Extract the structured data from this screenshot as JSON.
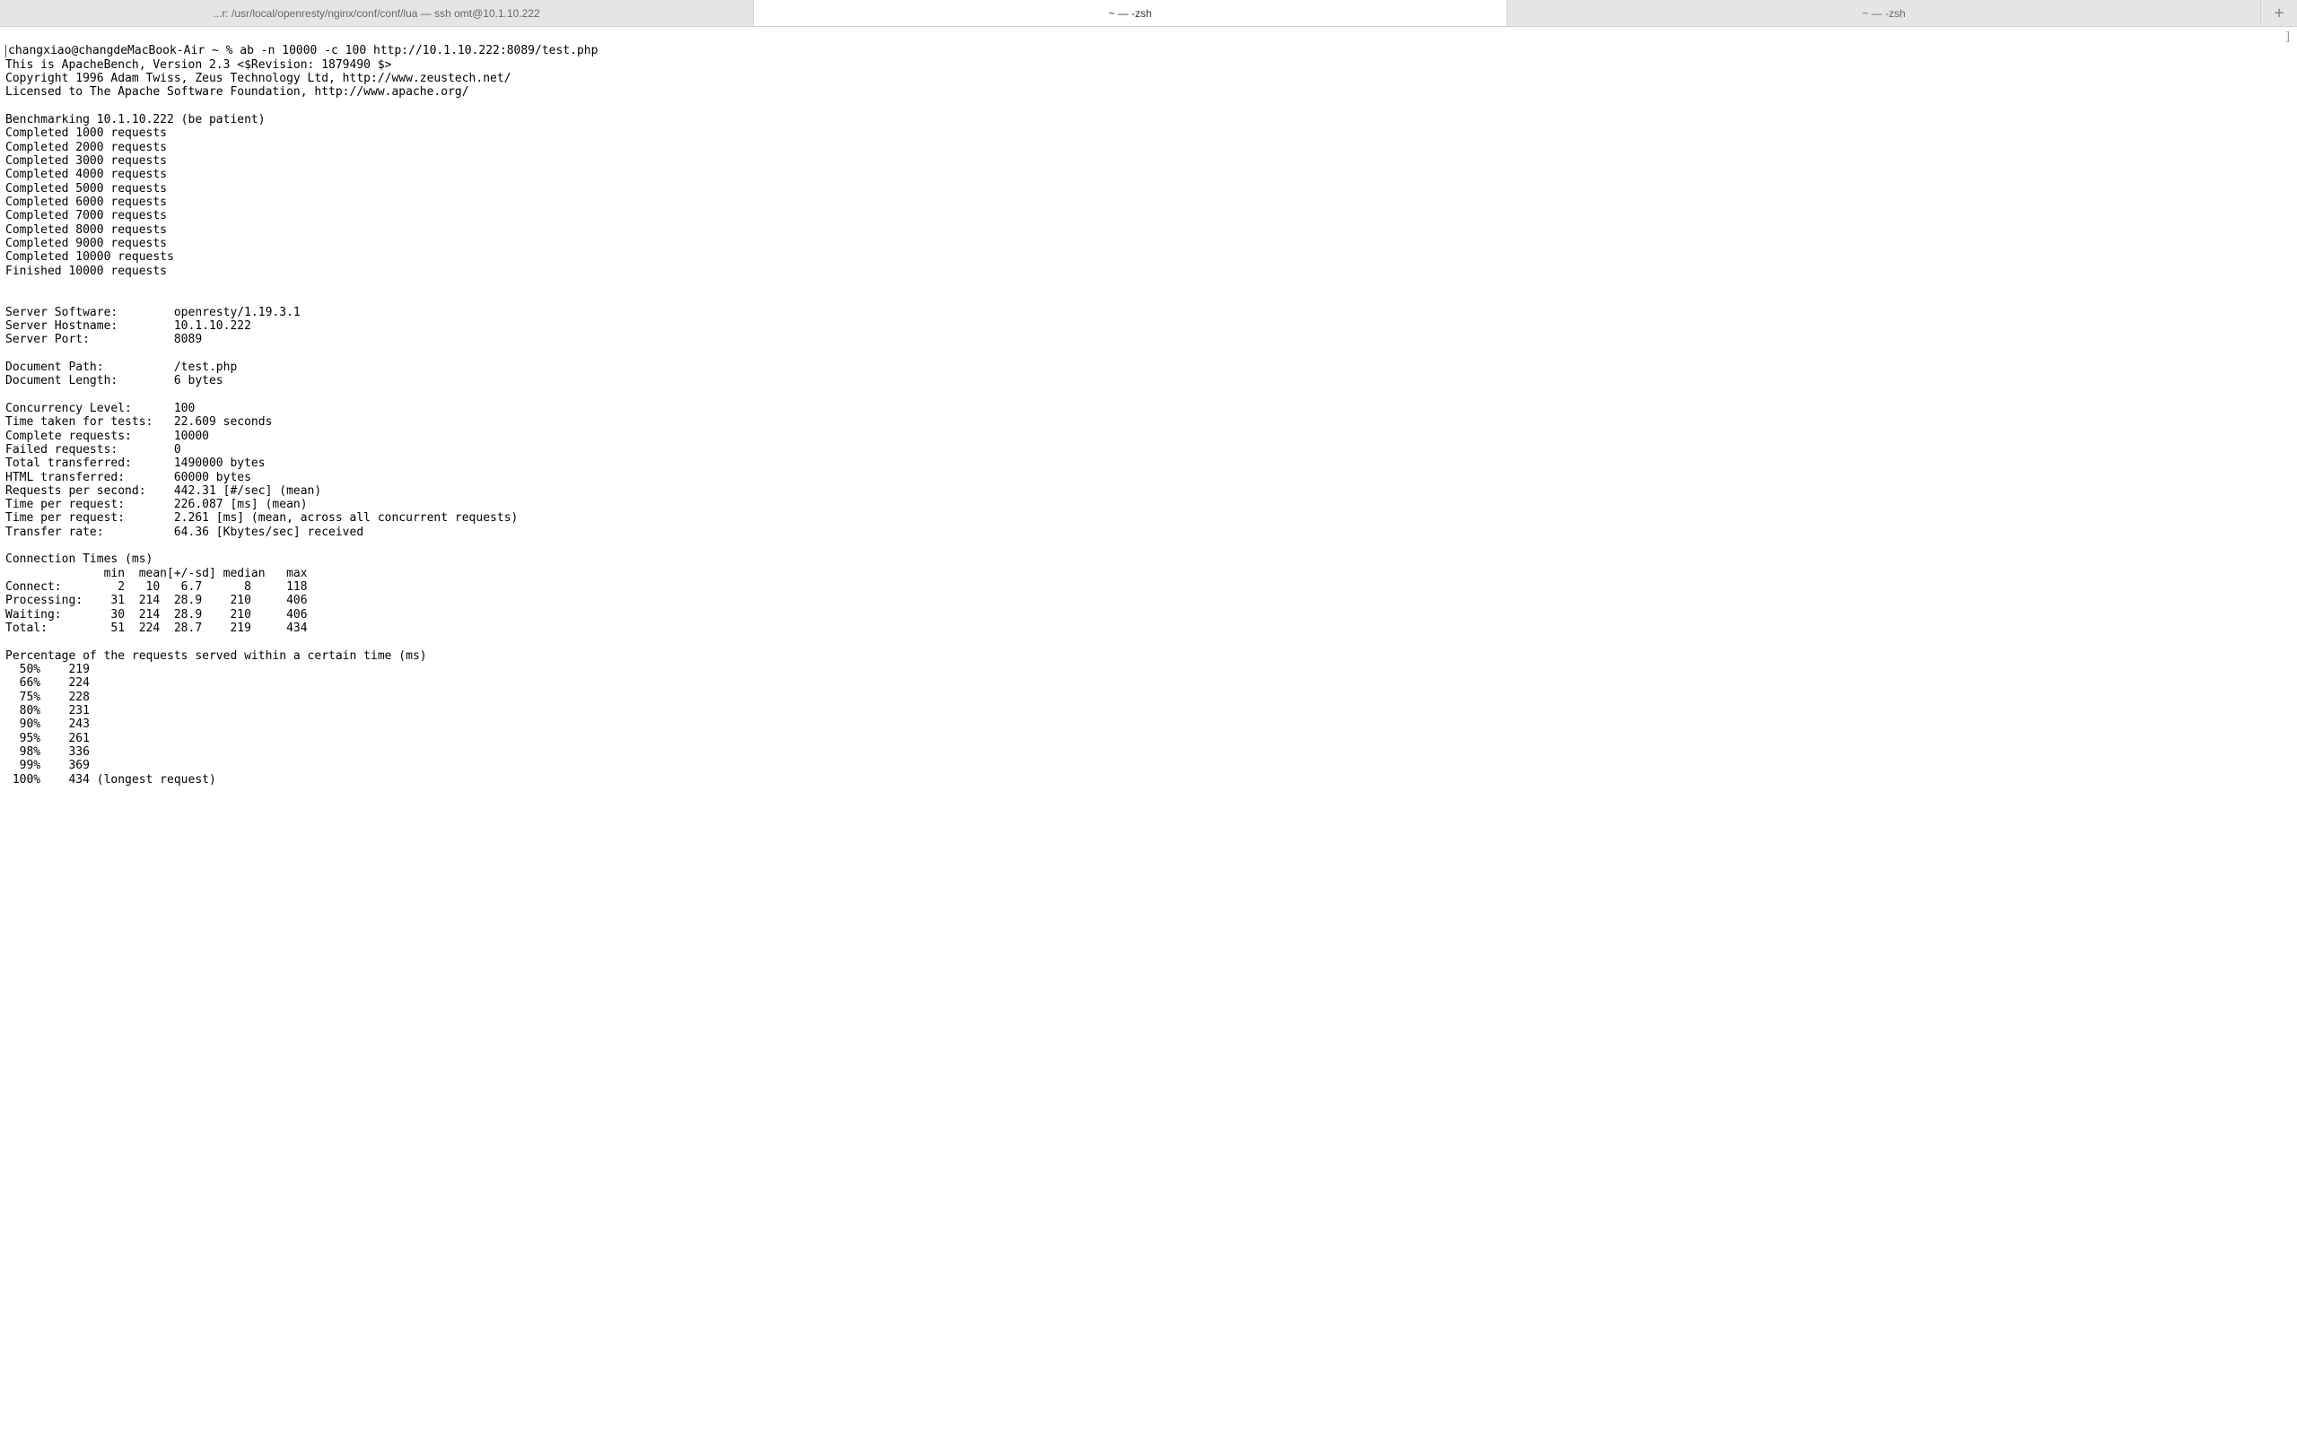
{
  "tabs": {
    "items": [
      {
        "label": "...r: /usr/local/openresty/nginx/conf/conf/lua — ssh omt@10.1.10.222",
        "active": false
      },
      {
        "label": "~ — -zsh",
        "active": true
      },
      {
        "label": "~ — -zsh",
        "active": false
      }
    ],
    "add_label": "+"
  },
  "terminal": {
    "right_bracket": "]",
    "prompt": "changxiao@changdeMacBook-Air ~ % ",
    "command": "ab -n 10000 -c 100 http://10.1.10.222:8089/test.php",
    "header_lines": [
      "This is ApacheBench, Version 2.3 <$Revision: 1879490 $>",
      "Copyright 1996 Adam Twiss, Zeus Technology Ltd, http://www.zeustech.net/",
      "Licensed to The Apache Software Foundation, http://www.apache.org/"
    ],
    "benchmarking_line": "Benchmarking 10.1.10.222 (be patient)",
    "progress_lines": [
      "Completed 1000 requests",
      "Completed 2000 requests",
      "Completed 3000 requests",
      "Completed 4000 requests",
      "Completed 5000 requests",
      "Completed 6000 requests",
      "Completed 7000 requests",
      "Completed 8000 requests",
      "Completed 9000 requests",
      "Completed 10000 requests",
      "Finished 10000 requests"
    ],
    "server_info": [
      {
        "label": "Server Software:",
        "value": "openresty/1.19.3.1"
      },
      {
        "label": "Server Hostname:",
        "value": "10.1.10.222"
      },
      {
        "label": "Server Port:",
        "value": "8089"
      }
    ],
    "document_info": [
      {
        "label": "Document Path:",
        "value": "/test.php"
      },
      {
        "label": "Document Length:",
        "value": "6 bytes"
      }
    ],
    "results": [
      {
        "label": "Concurrency Level:",
        "value": "100"
      },
      {
        "label": "Time taken for tests:",
        "value": "22.609 seconds"
      },
      {
        "label": "Complete requests:",
        "value": "10000"
      },
      {
        "label": "Failed requests:",
        "value": "0"
      },
      {
        "label": "Total transferred:",
        "value": "1490000 bytes"
      },
      {
        "label": "HTML transferred:",
        "value": "60000 bytes"
      },
      {
        "label": "Requests per second:",
        "value": "442.31 [#/sec] (mean)"
      },
      {
        "label": "Time per request:",
        "value": "226.087 [ms] (mean)"
      },
      {
        "label": "Time per request:",
        "value": "2.261 [ms] (mean, across all concurrent requests)"
      },
      {
        "label": "Transfer rate:",
        "value": "64.36 [Kbytes/sec] received"
      }
    ],
    "conn_times_header": "Connection Times (ms)",
    "conn_times_cols": "              min  mean[+/-sd] median   max",
    "conn_times_rows": [
      "Connect:        2   10   6.7      8     118",
      "Processing:    31  214  28.9    210     406",
      "Waiting:       30  214  28.9    210     406",
      "Total:         51  224  28.7    219     434"
    ],
    "percentile_header": "Percentage of the requests served within a certain time (ms)",
    "percentile_rows": [
      "  50%    219",
      "  66%    224",
      "  75%    228",
      "  80%    231",
      "  90%    243",
      "  95%    261",
      "  98%    336",
      "  99%    369",
      " 100%    434 (longest request)"
    ]
  }
}
